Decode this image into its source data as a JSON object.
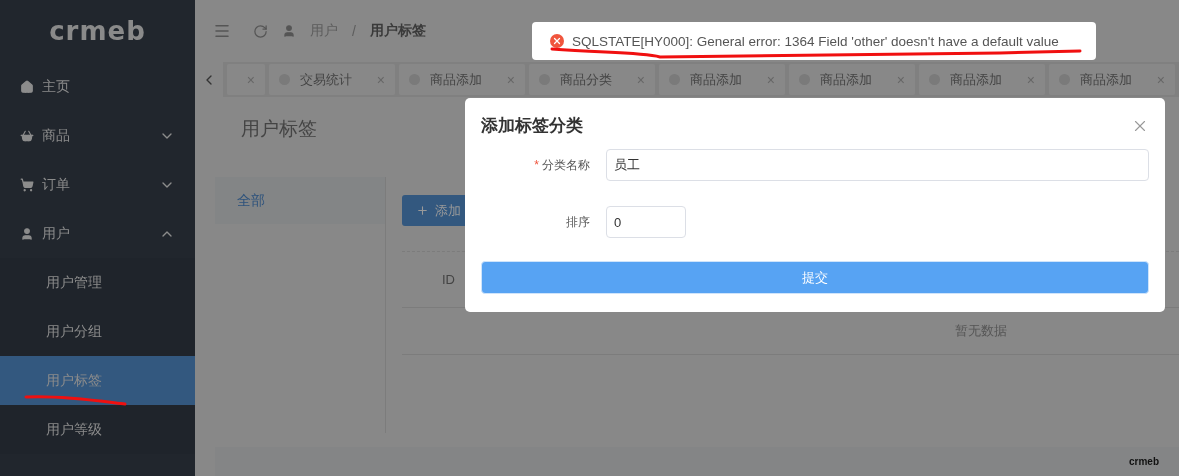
{
  "sidebar": {
    "logo": "crmeb",
    "items": [
      {
        "kind": "home",
        "label": "主页"
      },
      {
        "kind": "basket",
        "label": "商品",
        "expanded": false
      },
      {
        "kind": "cart",
        "label": "订单",
        "expanded": false
      },
      {
        "kind": "user",
        "label": "用户",
        "expanded": true,
        "children": [
          {
            "label": "用户管理",
            "selected": false
          },
          {
            "label": "用户分组",
            "selected": false
          },
          {
            "label": "用户标签",
            "selected": true
          },
          {
            "label": "用户等级",
            "selected": false
          }
        ]
      }
    ]
  },
  "header": {
    "breadcrumb": [
      "用户",
      "/",
      "用户标签"
    ]
  },
  "tabs": [
    {
      "kind": "partial",
      "close": "×"
    },
    {
      "kind": "full",
      "label": "交易统计",
      "close": "×"
    },
    {
      "kind": "full",
      "label": "商品添加",
      "close": "×"
    },
    {
      "kind": "full",
      "label": "商品分类",
      "close": "×"
    },
    {
      "kind": "full",
      "label": "商品添加",
      "close": "×"
    },
    {
      "kind": "full",
      "label": "商品添加",
      "close": "×"
    },
    {
      "kind": "full",
      "label": "商品添加",
      "close": "×"
    },
    {
      "kind": "full",
      "label": "商品添加",
      "close": "×"
    }
  ],
  "page_title": "用户标签",
  "categories": [
    {
      "label": "全部",
      "selected": true
    }
  ],
  "add_button": "添加",
  "table": {
    "columns": [
      "ID"
    ],
    "empty_text": "暂无数据"
  },
  "footer_logo": "crmeb",
  "toast": {
    "message": "SQLSTATE[HY000]: General error: 1364 Field 'other' doesn't have a default value"
  },
  "dialog": {
    "title": "添加标签分类",
    "fields": [
      {
        "label": "分类名称",
        "required_mark": "*",
        "value": "员工",
        "kind": "wide"
      },
      {
        "label": "排序",
        "value": "0",
        "kind": "narrow"
      }
    ],
    "submit": "提交"
  }
}
